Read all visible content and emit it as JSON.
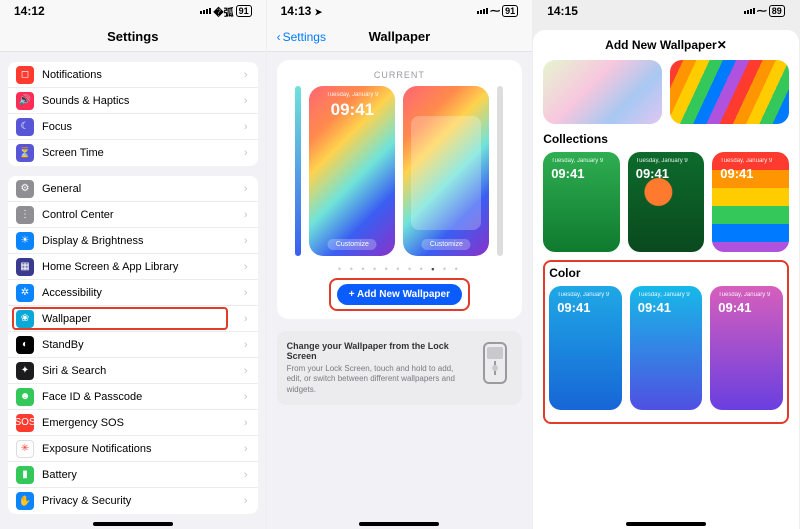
{
  "status": {
    "t1": "14:12",
    "t2": "14:13",
    "t3": "14:15",
    "batt1": "91",
    "batt2": "91",
    "batt3": "89",
    "loc_glyph": "➤"
  },
  "nav": {
    "settings_title": "Settings",
    "wallpaper_title": "Wallpaper",
    "back_label": "Settings",
    "addnew_title": "Add New Wallpaper"
  },
  "settings_groups": [
    {
      "rows": [
        {
          "icon_bg": "#ff3b30",
          "glyph": "◻",
          "label": "Notifications"
        },
        {
          "icon_bg": "#ff2d55",
          "glyph": "🔊",
          "label": "Sounds & Haptics"
        },
        {
          "icon_bg": "#5856d6",
          "glyph": "☾",
          "label": "Focus"
        },
        {
          "icon_bg": "#5856d6",
          "glyph": "⏳",
          "label": "Screen Time"
        }
      ]
    },
    {
      "rows": [
        {
          "icon_bg": "#8e8e93",
          "glyph": "⚙",
          "label": "General"
        },
        {
          "icon_bg": "#8e8e93",
          "glyph": "⋮",
          "label": "Control Center"
        },
        {
          "icon_bg": "#0a84ff",
          "glyph": "☀",
          "label": "Display & Brightness"
        },
        {
          "icon_bg": "#3a3a8f",
          "glyph": "▦",
          "label": "Home Screen & App Library"
        },
        {
          "icon_bg": "#0a84ff",
          "glyph": "✲",
          "label": "Accessibility"
        },
        {
          "icon_bg": "#0aa8d6",
          "glyph": "❀",
          "label": "Wallpaper",
          "highlight": true
        },
        {
          "icon_bg": "#000000",
          "glyph": "◐",
          "label": "StandBy"
        },
        {
          "icon_bg": "#1c1c1e",
          "glyph": "✦",
          "label": "Siri & Search"
        },
        {
          "icon_bg": "#34c759",
          "glyph": "☻",
          "label": "Face ID & Passcode"
        },
        {
          "icon_bg": "#ff3b30",
          "glyph": "SOS",
          "label": "Emergency SOS"
        },
        {
          "icon_bg": "#ffffff",
          "glyph": "✳",
          "label": "Exposure Notifications",
          "glyph_color": "#ff3b30"
        },
        {
          "icon_bg": "#34c759",
          "glyph": "▮",
          "label": "Battery"
        },
        {
          "icon_bg": "#0a84ff",
          "glyph": "✋",
          "label": "Privacy & Security"
        }
      ]
    }
  ],
  "wallpaper": {
    "current_label": "CURRENT",
    "clock": "09:41",
    "day": "Tuesday, January 9",
    "customize": "Customize",
    "add_button": "+ Add New Wallpaper",
    "tip_title": "Change your Wallpaper from the Lock Screen",
    "tip_body": "From your Lock Screen, touch and hold to add, edit, or switch between different wallpapers and widgets."
  },
  "addnew": {
    "collections_label": "Collections",
    "color_label": "Color",
    "clock": "09:41",
    "day": "Tuesday, January 9"
  }
}
